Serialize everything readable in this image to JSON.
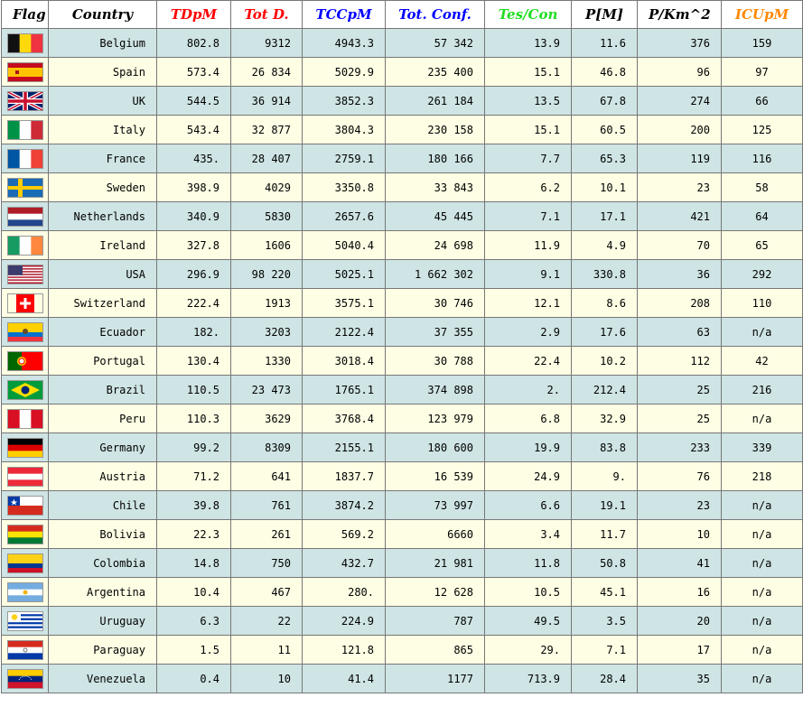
{
  "headers": [
    {
      "key": "flag",
      "label": "Flag",
      "color": "#000000"
    },
    {
      "key": "country",
      "label": "Country",
      "color": "#000000"
    },
    {
      "key": "tdpm",
      "label": "TDpM",
      "color": "#ff0000"
    },
    {
      "key": "totd",
      "label": "Tot D.",
      "color": "#ff0000"
    },
    {
      "key": "tccpm",
      "label": "TCCpM",
      "color": "#0000ff"
    },
    {
      "key": "totconf",
      "label": "Tot. Conf.",
      "color": "#0000ff"
    },
    {
      "key": "tescon",
      "label": "Tes/Con",
      "color": "#22dd22"
    },
    {
      "key": "pm",
      "label": "P[M]",
      "color": "#000000"
    },
    {
      "key": "pkm",
      "label": "P/Km^2",
      "color": "#000000"
    },
    {
      "key": "icupm",
      "label": "ICUpM",
      "color": "#ff8800"
    }
  ],
  "rows": [
    {
      "country": "Belgium",
      "flag_icon": "belgium-flag-icon",
      "tdpm": "802.8",
      "totd": "9312",
      "tccpm": "4943.3",
      "totconf": "57 342",
      "tescon": "13.9",
      "pm": "11.6",
      "pkm": "376",
      "icupm": "159"
    },
    {
      "country": "Spain",
      "flag_icon": "spain-flag-icon",
      "tdpm": "573.4",
      "totd": "26 834",
      "tccpm": "5029.9",
      "totconf": "235 400",
      "tescon": "15.1",
      "pm": "46.8",
      "pkm": "96",
      "icupm": "97"
    },
    {
      "country": "UK",
      "flag_icon": "uk-flag-icon",
      "tdpm": "544.5",
      "totd": "36 914",
      "tccpm": "3852.3",
      "totconf": "261 184",
      "tescon": "13.5",
      "pm": "67.8",
      "pkm": "274",
      "icupm": "66"
    },
    {
      "country": "Italy",
      "flag_icon": "italy-flag-icon",
      "tdpm": "543.4",
      "totd": "32 877",
      "tccpm": "3804.3",
      "totconf": "230 158",
      "tescon": "15.1",
      "pm": "60.5",
      "pkm": "200",
      "icupm": "125"
    },
    {
      "country": "France",
      "flag_icon": "france-flag-icon",
      "tdpm": "435.",
      "totd": "28 407",
      "tccpm": "2759.1",
      "totconf": "180 166",
      "tescon": "7.7",
      "pm": "65.3",
      "pkm": "119",
      "icupm": "116"
    },
    {
      "country": "Sweden",
      "flag_icon": "sweden-flag-icon",
      "tdpm": "398.9",
      "totd": "4029",
      "tccpm": "3350.8",
      "totconf": "33 843",
      "tescon": "6.2",
      "pm": "10.1",
      "pkm": "23",
      "icupm": "58"
    },
    {
      "country": "Netherlands",
      "flag_icon": "netherlands-flag-icon",
      "tdpm": "340.9",
      "totd": "5830",
      "tccpm": "2657.6",
      "totconf": "45 445",
      "tescon": "7.1",
      "pm": "17.1",
      "pkm": "421",
      "icupm": "64"
    },
    {
      "country": "Ireland",
      "flag_icon": "ireland-flag-icon",
      "tdpm": "327.8",
      "totd": "1606",
      "tccpm": "5040.4",
      "totconf": "24 698",
      "tescon": "11.9",
      "pm": "4.9",
      "pkm": "70",
      "icupm": "65"
    },
    {
      "country": "USA",
      "flag_icon": "usa-flag-icon",
      "tdpm": "296.9",
      "totd": "98 220",
      "tccpm": "5025.1",
      "totconf": "1 662 302",
      "tescon": "9.1",
      "pm": "330.8",
      "pkm": "36",
      "icupm": "292"
    },
    {
      "country": "Switzerland",
      "flag_icon": "switzerland-flag-icon",
      "tdpm": "222.4",
      "totd": "1913",
      "tccpm": "3575.1",
      "totconf": "30 746",
      "tescon": "12.1",
      "pm": "8.6",
      "pkm": "208",
      "icupm": "110"
    },
    {
      "country": "Ecuador",
      "flag_icon": "ecuador-flag-icon",
      "tdpm": "182.",
      "totd": "3203",
      "tccpm": "2122.4",
      "totconf": "37 355",
      "tescon": "2.9",
      "pm": "17.6",
      "pkm": "63",
      "icupm": "n/a"
    },
    {
      "country": "Portugal",
      "flag_icon": "portugal-flag-icon",
      "tdpm": "130.4",
      "totd": "1330",
      "tccpm": "3018.4",
      "totconf": "30 788",
      "tescon": "22.4",
      "pm": "10.2",
      "pkm": "112",
      "icupm": "42"
    },
    {
      "country": "Brazil",
      "flag_icon": "brazil-flag-icon",
      "tdpm": "110.5",
      "totd": "23 473",
      "tccpm": "1765.1",
      "totconf": "374 898",
      "tescon": "2.",
      "pm": "212.4",
      "pkm": "25",
      "icupm": "216"
    },
    {
      "country": "Peru",
      "flag_icon": "peru-flag-icon",
      "tdpm": "110.3",
      "totd": "3629",
      "tccpm": "3768.4",
      "totconf": "123 979",
      "tescon": "6.8",
      "pm": "32.9",
      "pkm": "25",
      "icupm": "n/a"
    },
    {
      "country": "Germany",
      "flag_icon": "germany-flag-icon",
      "tdpm": "99.2",
      "totd": "8309",
      "tccpm": "2155.1",
      "totconf": "180 600",
      "tescon": "19.9",
      "pm": "83.8",
      "pkm": "233",
      "icupm": "339"
    },
    {
      "country": "Austria",
      "flag_icon": "austria-flag-icon",
      "tdpm": "71.2",
      "totd": "641",
      "tccpm": "1837.7",
      "totconf": "16 539",
      "tescon": "24.9",
      "pm": "9.",
      "pkm": "76",
      "icupm": "218"
    },
    {
      "country": "Chile",
      "flag_icon": "chile-flag-icon",
      "tdpm": "39.8",
      "totd": "761",
      "tccpm": "3874.2",
      "totconf": "73 997",
      "tescon": "6.6",
      "pm": "19.1",
      "pkm": "23",
      "icupm": "n/a"
    },
    {
      "country": "Bolivia",
      "flag_icon": "bolivia-flag-icon",
      "tdpm": "22.3",
      "totd": "261",
      "tccpm": "569.2",
      "totconf": "6660",
      "tescon": "3.4",
      "pm": "11.7",
      "pkm": "10",
      "icupm": "n/a"
    },
    {
      "country": "Colombia",
      "flag_icon": "colombia-flag-icon",
      "tdpm": "14.8",
      "totd": "750",
      "tccpm": "432.7",
      "totconf": "21 981",
      "tescon": "11.8",
      "pm": "50.8",
      "pkm": "41",
      "icupm": "n/a"
    },
    {
      "country": "Argentina",
      "flag_icon": "argentina-flag-icon",
      "tdpm": "10.4",
      "totd": "467",
      "tccpm": "280.",
      "totconf": "12 628",
      "tescon": "10.5",
      "pm": "45.1",
      "pkm": "16",
      "icupm": "n/a"
    },
    {
      "country": "Uruguay",
      "flag_icon": "uruguay-flag-icon",
      "tdpm": "6.3",
      "totd": "22",
      "tccpm": "224.9",
      "totconf": "787",
      "tescon": "49.5",
      "pm": "3.5",
      "pkm": "20",
      "icupm": "n/a"
    },
    {
      "country": "Paraguay",
      "flag_icon": "paraguay-flag-icon",
      "tdpm": "1.5",
      "totd": "11",
      "tccpm": "121.8",
      "totconf": "865",
      "tescon": "29.",
      "pm": "7.1",
      "pkm": "17",
      "icupm": "n/a"
    },
    {
      "country": "Venezuela",
      "flag_icon": "venezuela-flag-icon",
      "tdpm": "0.4",
      "totd": "10",
      "tccpm": "41.4",
      "totconf": "1177",
      "tescon": "713.9",
      "pm": "28.4",
      "pkm": "35",
      "icupm": "n/a"
    }
  ],
  "colors": {
    "row_odd": "#cfe4e4",
    "row_even": "#fefee4",
    "border": "#777777"
  }
}
